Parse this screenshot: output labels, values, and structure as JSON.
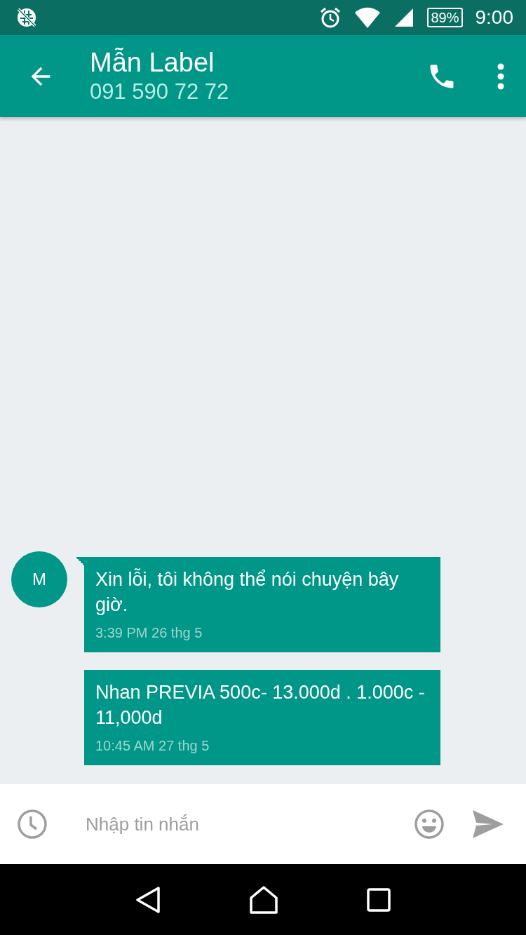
{
  "status_bar": {
    "battery": "89%",
    "time": "9:00"
  },
  "app_bar": {
    "title": "Mẫn Label",
    "subtitle": "091 590 72 72"
  },
  "messages": [
    {
      "avatar": "M",
      "text": "Xin lỗi, tôi không thể nói chuyện bây giờ.",
      "time": "3:39 PM 26 thg 5"
    },
    {
      "text": "Nhan PREVIA 500c- 13.000d . 1.000c - 11,000d",
      "time": "10:45 AM 27 thg 5"
    }
  ],
  "compose": {
    "placeholder": "Nhập tin nhắn"
  }
}
